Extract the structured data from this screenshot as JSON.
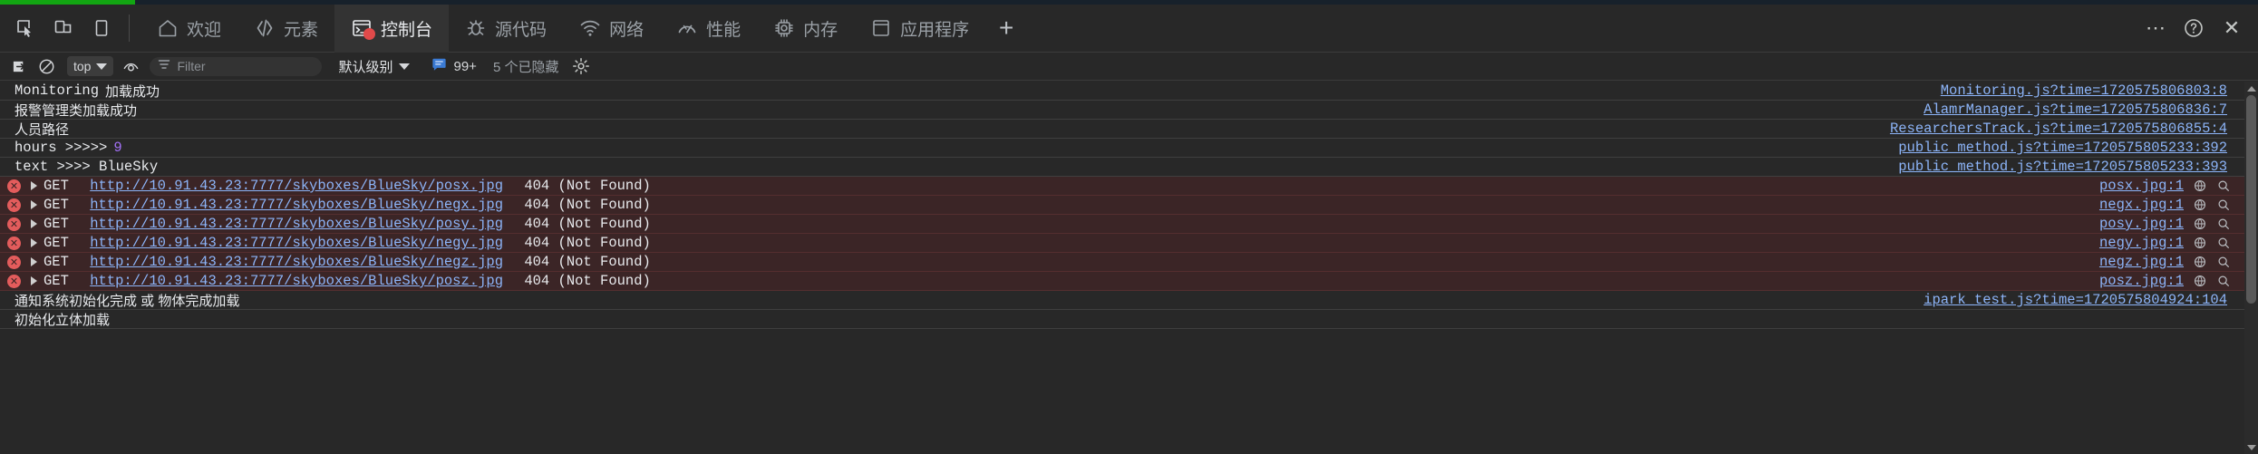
{
  "progress": {
    "percent": 6,
    "color": "#12a512"
  },
  "dock": {
    "buttons": [
      {
        "name": "inspect-element-icon",
        "title": "检查元素"
      },
      {
        "name": "device-toolbar-icon",
        "title": "切换设备工具栏"
      },
      {
        "name": "dock-side-icon",
        "title": "停靠位置"
      }
    ]
  },
  "tabs": [
    {
      "id": "welcome",
      "label": "欢迎",
      "icon": "home-icon",
      "selected": false,
      "error_badge": false
    },
    {
      "id": "elements",
      "label": "元素",
      "icon": "code-icon",
      "selected": false,
      "error_badge": false
    },
    {
      "id": "console",
      "label": "控制台",
      "icon": "console-icon",
      "selected": true,
      "error_badge": true
    },
    {
      "id": "sources",
      "label": "源代码",
      "icon": "bug-icon",
      "selected": false,
      "error_badge": false
    },
    {
      "id": "network",
      "label": "网络",
      "icon": "wifi-icon",
      "selected": false,
      "error_badge": false
    },
    {
      "id": "performance",
      "label": "性能",
      "icon": "gauge-icon",
      "selected": false,
      "error_badge": false
    },
    {
      "id": "memory",
      "label": "内存",
      "icon": "chip-icon",
      "selected": false,
      "error_badge": false
    },
    {
      "id": "application",
      "label": "应用程序",
      "icon": "application-icon",
      "selected": false,
      "error_badge": false
    }
  ],
  "add_tab_label": "+",
  "window_controls": {
    "more_label": "⋯",
    "help_label": "?",
    "close_label": "✕"
  },
  "filterbar": {
    "clear_console_icon": "clear-console-icon",
    "no_entry_icon": "no-entry-icon",
    "context_value": "top",
    "eye_icon": "live-expression-icon",
    "filter_icon": "filter-icon",
    "filter_value": "",
    "filter_placeholder": "Filter",
    "level_label": "默认级别",
    "issues_count": "99+",
    "issues_icon": "issues-bubble-icon",
    "hidden_label": "5 个已隐藏",
    "settings_icon": "gear-icon"
  },
  "console_rows": [
    {
      "type": "log",
      "parts": [
        {
          "text": "Monitoring",
          "style": "mono"
        },
        {
          "text": "加载成功",
          "style": "cjk"
        }
      ],
      "source": "Monitoring.js?time=1720575806803:8"
    },
    {
      "type": "log",
      "parts": [
        {
          "text": "报警管理类加载成功",
          "style": "cjk"
        }
      ],
      "source": "AlamrManager.js?time=1720575806836:7"
    },
    {
      "type": "log",
      "parts": [
        {
          "text": "人员路径",
          "style": "cjk"
        }
      ],
      "source": "ResearchersTrack.js?time=1720575806855:4"
    },
    {
      "type": "log",
      "parts": [
        {
          "text": "hours >>>>> ",
          "style": "mono"
        },
        {
          "text": "9",
          "style": "number"
        }
      ],
      "source": "public_method.js?time=1720575805233:392"
    },
    {
      "type": "log",
      "parts": [
        {
          "text": "text >>>> BlueSky",
          "style": "mono"
        }
      ],
      "source": "public_method.js?time=1720575805233:393"
    },
    {
      "type": "error",
      "method": "GET",
      "url": "http://10.91.43.23:7777/skyboxes/BlueSky/posx.jpg",
      "status": "404 (Not Found)",
      "source": "posx.jpg:1"
    },
    {
      "type": "error",
      "method": "GET",
      "url": "http://10.91.43.23:7777/skyboxes/BlueSky/negx.jpg",
      "status": "404 (Not Found)",
      "source": "negx.jpg:1"
    },
    {
      "type": "error",
      "method": "GET",
      "url": "http://10.91.43.23:7777/skyboxes/BlueSky/posy.jpg",
      "status": "404 (Not Found)",
      "source": "posy.jpg:1"
    },
    {
      "type": "error",
      "method": "GET",
      "url": "http://10.91.43.23:7777/skyboxes/BlueSky/negy.jpg",
      "status": "404 (Not Found)",
      "source": "negy.jpg:1"
    },
    {
      "type": "error",
      "method": "GET",
      "url": "http://10.91.43.23:7777/skyboxes/BlueSky/negz.jpg",
      "status": "404 (Not Found)",
      "source": "negz.jpg:1"
    },
    {
      "type": "error",
      "method": "GET",
      "url": "http://10.91.43.23:7777/skyboxes/BlueSky/posz.jpg",
      "status": "404 (Not Found)",
      "source": "posz.jpg:1"
    },
    {
      "type": "log",
      "parts": [
        {
          "text": "通知系统初始化完成 或 物体完成加载",
          "style": "cjk"
        }
      ],
      "source": "ipark_test.js?time=1720575804924:104"
    },
    {
      "type": "log",
      "parts": [
        {
          "text": "初始化立体加载",
          "style": "cjk"
        }
      ],
      "source": ""
    }
  ],
  "scrollbar": {
    "up_arrow": "scroll-up-arrow",
    "down_arrow": "scroll-down-arrow"
  }
}
